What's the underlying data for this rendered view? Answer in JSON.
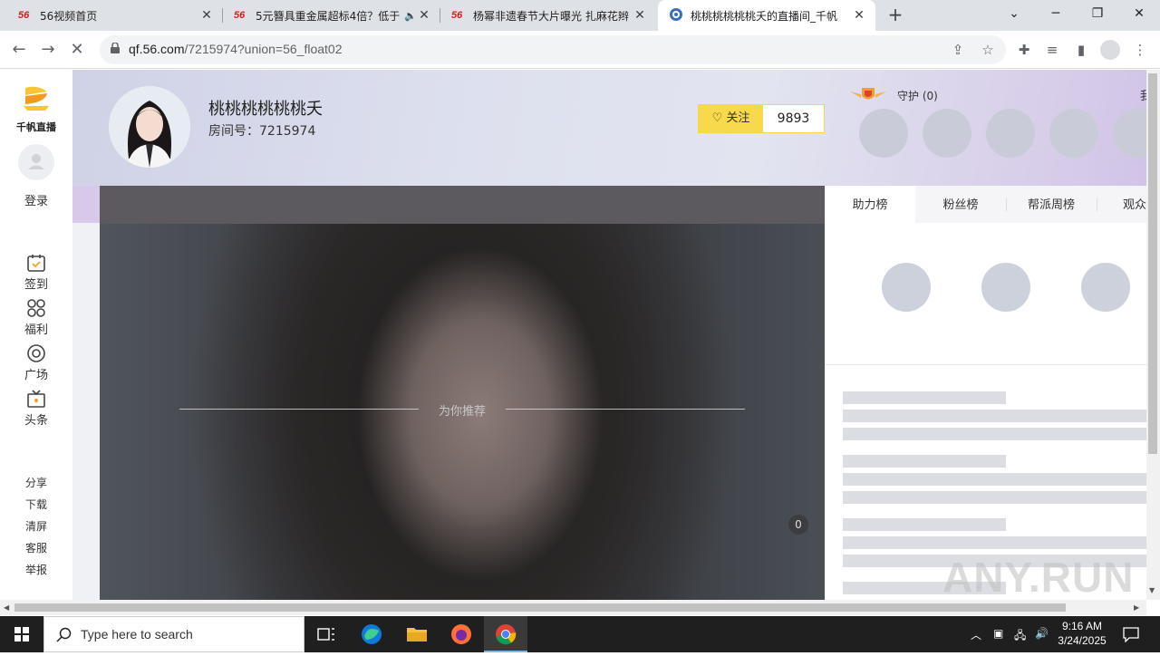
{
  "browser": {
    "tabs": [
      {
        "favicon": "56",
        "title": "56视频首页"
      },
      {
        "favicon": "56",
        "title": "5元簪具重金属超标4倍？低于"
      },
      {
        "favicon": "56",
        "title": "杨幂非遗春节大片曝光 扎麻花辫"
      },
      {
        "favicon": "globe",
        "title": "桃桃桃桃桃桃夭的直播间_千帆"
      }
    ],
    "new_tab": "+",
    "url_host": "qf.56.com",
    "url_path": "/7215974?union=56_float02"
  },
  "sidebar": {
    "brand": "千帆直播",
    "login": "登录",
    "nav": [
      {
        "label": "签到",
        "icon": "calendar-check-icon"
      },
      {
        "label": "福利",
        "icon": "gift-grid-icon"
      },
      {
        "label": "广场",
        "icon": "plaza-circle-icon"
      },
      {
        "label": "头条",
        "icon": "tv-headline-icon"
      }
    ],
    "utils": [
      "分享",
      "下载",
      "清屏",
      "客服",
      "举报"
    ]
  },
  "room": {
    "host_name": "桃桃桃桃桃桃夭",
    "room_id_label": "房间号：7215974",
    "follow_label": "关注",
    "follower_count": "9893",
    "guard_label": "守护 (0)",
    "edge_text": "我"
  },
  "video": {
    "recommend_title": "为你推荐",
    "viewer_badge": "0"
  },
  "rank": {
    "tabs": [
      "助力榜",
      "粉丝榜",
      "帮派周榜",
      "观众"
    ]
  },
  "watermark": "ANY.RUN",
  "taskbar": {
    "search_placeholder": "Type here to search",
    "time": "9:16 AM",
    "date": "3/24/2025"
  },
  "colors": {
    "follow_yellow": "#f8d94c",
    "tab_bar": "#dee1e6",
    "favicon_red": "#e0191b"
  }
}
